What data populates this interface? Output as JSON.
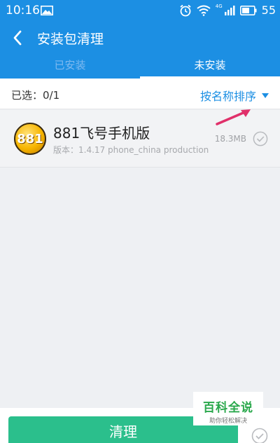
{
  "status_bar": {
    "time": "10:16",
    "signal_label": "4G",
    "battery": "55",
    "icons": [
      "image-icon",
      "alarm-icon",
      "wifi-icon",
      "signal-icon",
      "battery-icon"
    ]
  },
  "header": {
    "title": "安装包清理"
  },
  "tabs": [
    {
      "label": "已安装",
      "active": false
    },
    {
      "label": "未安装",
      "active": true
    }
  ],
  "filter": {
    "selected_text": "已选：0/1",
    "sort_label": "按名称排序"
  },
  "items": [
    {
      "icon_text": "881",
      "name": "881飞号手机版",
      "version": "版本：1.4.17 phone_china production",
      "size": "18.3MB",
      "checked": false
    }
  ],
  "bottom": {
    "clean_label": "清理"
  },
  "watermark": {
    "title": "百科全说",
    "subtitle": "助你轻松解决"
  },
  "colors": {
    "primary": "#1c8fe3",
    "clean_button": "#2bbf8c",
    "annotation_arrow": "#e0306a"
  }
}
